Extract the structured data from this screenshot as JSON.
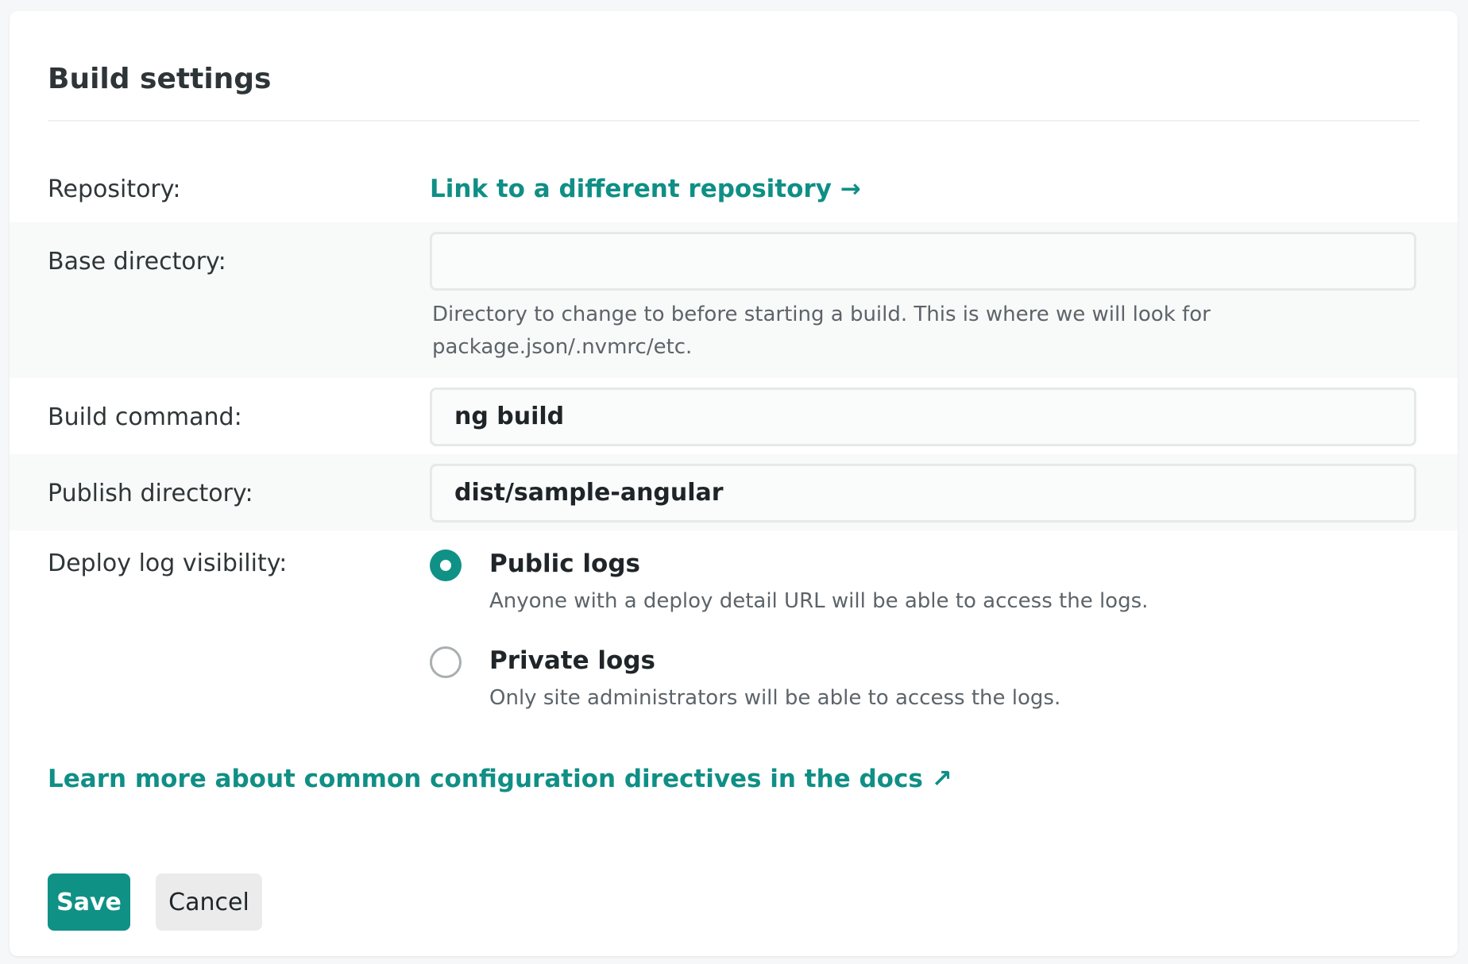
{
  "card": {
    "title": "Build settings"
  },
  "fields": {
    "repository": {
      "label": "Repository:",
      "link": "Link to a different repository",
      "link_arrow": "→"
    },
    "base_directory": {
      "label": "Base directory:",
      "value": "",
      "help_line1": "Directory to change to before starting a build. This is where we will look for",
      "help_line2": "package.json/.nvmrc/etc."
    },
    "build_command": {
      "label": "Build command:",
      "value": "ng build"
    },
    "publish_directory": {
      "label": "Publish directory:",
      "value": "dist/sample-angular"
    },
    "deploy_log_visibility": {
      "label": "Deploy log visibility:",
      "options": [
        {
          "title": "Public logs",
          "description": "Anyone with a deploy detail URL will be able to access the logs.",
          "checked": true
        },
        {
          "title": "Private logs",
          "description": "Only site administrators will be able to access the logs.",
          "checked": false
        }
      ]
    }
  },
  "docs_link": {
    "text": "Learn more about common configuration directives in the docs",
    "arrow": "↗"
  },
  "actions": {
    "save_label": "Save",
    "cancel_label": "Cancel"
  },
  "colors": {
    "accent": "#0f9186",
    "link": "#0f8f85",
    "shaded_row": "#f8f9f9",
    "input_border": "#e6e8e9"
  }
}
